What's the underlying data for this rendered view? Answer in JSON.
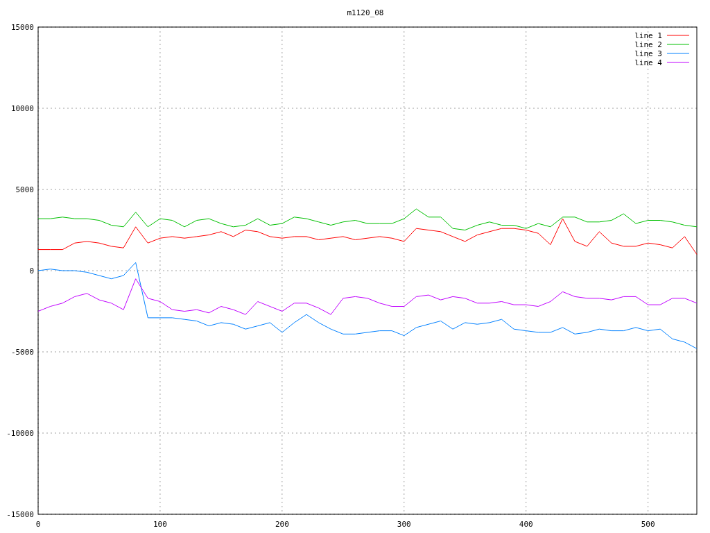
{
  "chart_data": {
    "type": "line",
    "title": "m1120_08",
    "x": [
      0,
      10,
      20,
      30,
      40,
      50,
      60,
      70,
      80,
      90,
      100,
      110,
      120,
      130,
      140,
      150,
      160,
      170,
      180,
      190,
      200,
      210,
      220,
      230,
      240,
      250,
      260,
      270,
      280,
      290,
      300,
      310,
      320,
      330,
      340,
      350,
      360,
      370,
      380,
      390,
      400,
      410,
      420,
      430,
      440,
      450,
      460,
      470,
      480,
      490,
      500,
      510,
      520,
      530,
      540
    ],
    "grid": true,
    "legend": true,
    "xlim": [
      0,
      540
    ],
    "ylim": [
      -15000,
      15000
    ],
    "xticks": [
      0,
      100,
      200,
      300,
      400,
      500
    ],
    "yticks": [
      -15000,
      -10000,
      -5000,
      0,
      5000,
      10000,
      15000
    ],
    "series": [
      {
        "name": "line 1",
        "color": "#ff0000",
        "values": [
          1300,
          1300,
          1300,
          1700,
          1800,
          1700,
          1500,
          1400,
          2700,
          1700,
          2000,
          2100,
          2000,
          2100,
          2200,
          2400,
          2100,
          2500,
          2400,
          2100,
          2000,
          2100,
          2100,
          1900,
          2000,
          2100,
          1900,
          2000,
          2100,
          2000,
          1800,
          2600,
          2500,
          2400,
          2100,
          1800,
          2200,
          2400,
          2600,
          2600,
          2500,
          2300,
          1600,
          3200,
          1800,
          1500,
          2400,
          1700,
          1500,
          1500,
          1700,
          1600,
          1400,
          2100,
          1000
        ]
      },
      {
        "name": "line 2",
        "color": "#00c000",
        "values": [
          3200,
          3200,
          3300,
          3200,
          3200,
          3100,
          2800,
          2700,
          3600,
          2700,
          3200,
          3100,
          2700,
          3100,
          3200,
          2900,
          2700,
          2800,
          3200,
          2800,
          2900,
          3300,
          3200,
          3000,
          2800,
          3000,
          3100,
          2900,
          2900,
          2900,
          3200,
          3800,
          3300,
          3300,
          2600,
          2500,
          2800,
          3000,
          2800,
          2800,
          2600,
          2900,
          2700,
          3300,
          3300,
          3000,
          3000,
          3100,
          3500,
          2900,
          3100,
          3100,
          3000,
          2800,
          2700
        ]
      },
      {
        "name": "line 3",
        "color": "#0080ff",
        "values": [
          0,
          100,
          0,
          0,
          -100,
          -300,
          -500,
          -300,
          500,
          -2900,
          -2900,
          -2900,
          -3000,
          -3100,
          -3400,
          -3200,
          -3300,
          -3600,
          -3400,
          -3200,
          -3800,
          -3200,
          -2700,
          -3200,
          -3600,
          -3900,
          -3900,
          -3800,
          -3700,
          -3700,
          -4000,
          -3500,
          -3300,
          -3100,
          -3600,
          -3200,
          -3300,
          -3200,
          -3000,
          -3600,
          -3700,
          -3800,
          -3800,
          -3500,
          -3900,
          -3800,
          -3600,
          -3700,
          -3700,
          -3500,
          -3700,
          -3600,
          -4200,
          -4400,
          -4800
        ]
      },
      {
        "name": "line 4",
        "color": "#c000ff",
        "values": [
          -2500,
          -2200,
          -2000,
          -1600,
          -1400,
          -1800,
          -2000,
          -2400,
          -500,
          -1700,
          -1900,
          -2400,
          -2500,
          -2400,
          -2600,
          -2200,
          -2400,
          -2700,
          -1900,
          -2200,
          -2500,
          -2000,
          -2000,
          -2300,
          -2700,
          -1700,
          -1600,
          -1700,
          -2000,
          -2200,
          -2200,
          -1600,
          -1500,
          -1800,
          -1600,
          -1700,
          -2000,
          -2000,
          -1900,
          -2100,
          -2100,
          -2200,
          -1900,
          -1300,
          -1600,
          -1700,
          -1700,
          -1800,
          -1600,
          -1600,
          -2100,
          -2100,
          -1700,
          -1700,
          -2000
        ]
      }
    ]
  }
}
